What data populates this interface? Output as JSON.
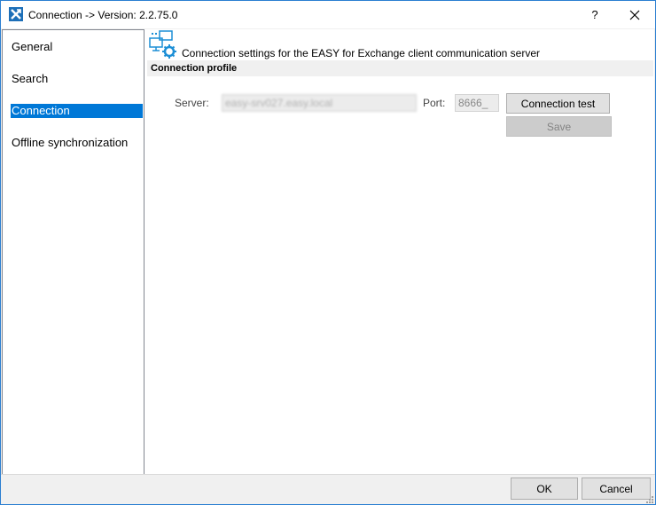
{
  "window": {
    "title": "Connection -> Version: 2.2.75.0",
    "help_label": "?"
  },
  "sidebar": {
    "items": [
      {
        "label": "General"
      },
      {
        "label": "Search"
      },
      {
        "label": "Connection"
      },
      {
        "label": "Offline synchronization"
      }
    ],
    "selected_index": 2
  },
  "main": {
    "header_description": "Connection settings for the EASY for Exchange client communication server",
    "section_title": "Connection profile",
    "server": {
      "label": "Server:",
      "value": "easy-srv027.easy.local"
    },
    "port": {
      "label": "Port:",
      "value": "8666_"
    },
    "connection_test_label": "Connection test",
    "save_label": "Save"
  },
  "footer": {
    "ok_label": "OK",
    "cancel_label": "Cancel"
  },
  "colors": {
    "accent": "#0078d7",
    "window_border": "#2b7fd1",
    "icon_blue": "#1d8fd6"
  }
}
